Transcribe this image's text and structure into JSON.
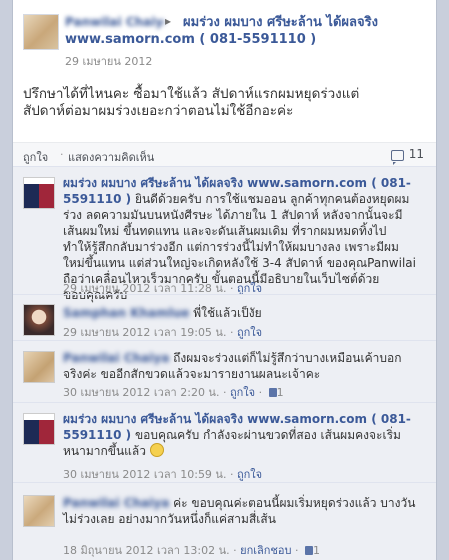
{
  "post": {
    "author": "Panwilai Chaiya",
    "arrow": "▸",
    "target_page": "ผมร่วง ผมบาง ศรีษะล้าน ได้ผลจริง www.samorn.com ( 081-5591110 )",
    "date": "29 เมษายน 2012",
    "body": "ปรึกษาได้ที่ไหนคะ ซื้อมาใช้แล้ว สัปดาห์แรกผมหยุดร่วงแต่\nสัปดาห์ต่อมาผมร่วงเยอะกว่าตอนไม่ใช้อีกอะค่ะ",
    "actions": {
      "like": "ถูกใจ",
      "separator": "·",
      "show_comments": "แสดงความคิดเห็น",
      "comment_count": "11"
    }
  },
  "comments": [
    {
      "author": "ผมร่วง ผมบาง ศรีษะล้าน ได้ผลจริง www.samorn.com ( 081-5591110 )",
      "text": "ยินดีด้วยครับ การใช้แชมออน ลูกค้าทุกคนต้องหยุดผมร่วง ลดความมันบนหนังศีรษะ ได้ภายใน 1 สัปดาห์ หลังจากนั้นจะมีเส้นผมใหม่ ขึ้นทดแทน และจะดันเส้นผมเดิม ที่รากผมหมดทิ้งไป ทำให้รู้สึกกลับมาร่วงอีก แต่การร่วงนี้ไม่ทำให้ผมบางลง เพราะมีผมใหม่ขึ้นแทน แต่ส่วนใหญ่จะเกิดหลังใช้ 3-4 สัปดาห์ ของคุณPanwilai ถือว่าเคลื่อนไหวเร็วมากครับ ขั้นตอนนี้มีอธิบายในเว็บไซต์ด้วย ขอบคุณครับ",
      "time": "29 เมษายน 2012 เวลา 11:28 น.",
      "like": "ถูกใจ"
    },
    {
      "author": "Samphan Khamlue",
      "text": "พี่ใช้แล้วเป็งัย",
      "time": "29 เมษายน 2012 เวลา 19:05 น.",
      "like": "ถูกใจ"
    },
    {
      "author": "Panwilai Chaiya",
      "text": "ถึงผมจะร่วงแต่ก็ไม่รู้สึกว่าบางเหมือนเค้าบอกจริงค่ะ ขออีกสักขวดแล้วจะมารายงานผลนะเจ้าคะ",
      "time": "30 เมษายน 2012 เวลา 2:20 น.",
      "like": "ถูกใจ",
      "likes": "1"
    },
    {
      "author": "ผมร่วง ผมบาง ศรีษะล้าน ได้ผลจริง www.samorn.com ( 081-5591110 )",
      "text": "ขอบคุณครับ กำลังจะผ่านขวดที่สอง เส้นผมคงจะเริ่มหนามากขึ้นแล้ว",
      "time": "30 เมษายน 2012 เวลา 10:59 น.",
      "like": "ถูกใจ"
    },
    {
      "author": "Panwilai Chaiya",
      "text": "ค่ะ ขอบคุณค่ะตอนนี้ผมเริ่มหยุดร่วงแล้ว บางวันไม่ร่วงเลย อย่างมากวันหนึ่งก็แค่สามสี่เส้น",
      "time": "18 มิถุนายน 2012 เวลา 13:02 น.",
      "like": "ยกเลิกชอบ",
      "likes": "1"
    }
  ]
}
